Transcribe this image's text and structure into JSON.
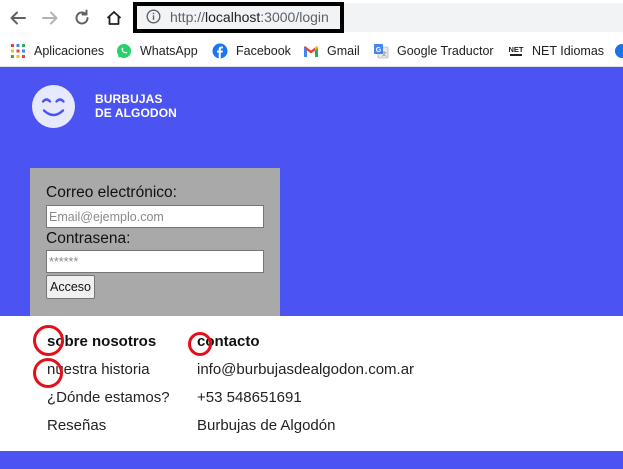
{
  "browser": {
    "url_scheme": "http://",
    "url_host": "localhost",
    "url_path": ":3000/login"
  },
  "bookmarks": [
    {
      "label": "Aplicaciones",
      "icon": "apps-grid-icon"
    },
    {
      "label": "WhatsApp",
      "icon": "whatsapp-icon"
    },
    {
      "label": "Facebook",
      "icon": "facebook-icon"
    },
    {
      "label": "Gmail",
      "icon": "gmail-icon"
    },
    {
      "label": "Google Traductor",
      "icon": "google-translate-icon"
    },
    {
      "label": "NET Idiomas",
      "icon": "net-idiomas-icon"
    }
  ],
  "brand": {
    "line1": "BURBUJAS",
    "line2": "DE ALGODON",
    "logo_icon": "smiley-face-icon"
  },
  "login": {
    "email_label": "Correo electrónico:",
    "email_placeholder": "Email@ejemplo.com",
    "password_label": "Contrasena:",
    "password_placeholder": "******",
    "submit_label": "Acceso"
  },
  "footer": {
    "about": {
      "heading": "sobre nosotros",
      "items": [
        "nuestra historia",
        "¿Dónde estamos?",
        "Reseñas"
      ]
    },
    "contact": {
      "heading": "contacto",
      "items": [
        "info@burbujasdealgodon.com.ar",
        "+53 548651691",
        "Burbujas de Algodón"
      ]
    }
  },
  "colors": {
    "brand_blue": "#4b53f2",
    "login_box_gray": "#a9a9a9",
    "annotation_red": "#e3101a"
  }
}
